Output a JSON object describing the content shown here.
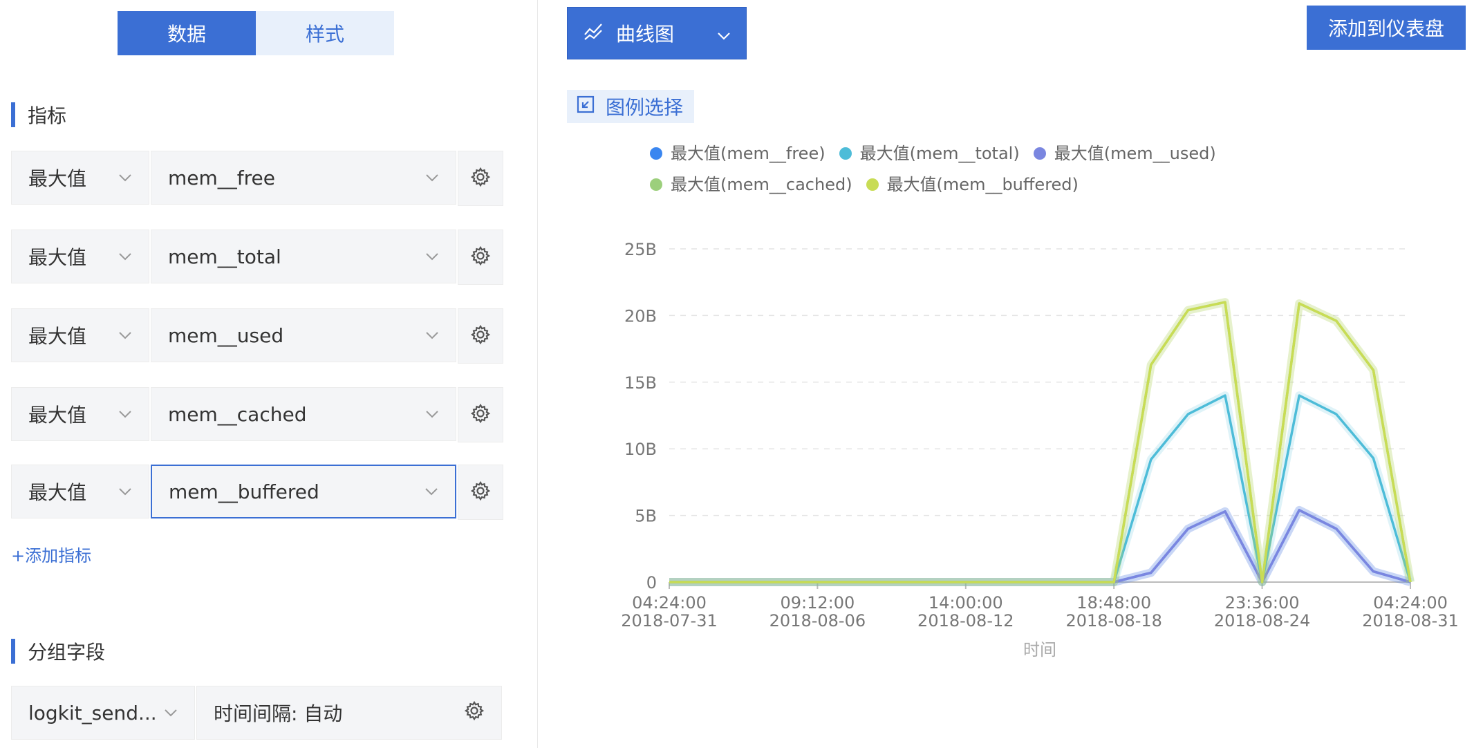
{
  "left": {
    "tabs": [
      {
        "label": "数据",
        "active": true
      },
      {
        "label": "样式",
        "active": false
      }
    ],
    "metrics_title": "指标",
    "metrics": [
      {
        "agg": "最大值",
        "field": "mem__free",
        "focused": false
      },
      {
        "agg": "最大值",
        "field": "mem__total",
        "focused": false
      },
      {
        "agg": "最大值",
        "field": "mem__used",
        "focused": false
      },
      {
        "agg": "最大值",
        "field": "mem__cached",
        "focused": false
      },
      {
        "agg": "最大值",
        "field": "mem__buffered",
        "focused": true
      }
    ],
    "add_metric_label": "+添加指标",
    "group_title": "分组字段",
    "group_field": "logkit_send...",
    "interval_label": "时间间隔: 自动"
  },
  "right": {
    "chart_type_label": "曲线图",
    "add_dashboard_label": "添加到仪表盘",
    "legend_select_label": "图例选择"
  },
  "colors": {
    "accent": "#3b6fd4",
    "free": "#3a86f0",
    "total": "#4dbcd8",
    "used": "#7a86e0",
    "cached": "#9ccf7c",
    "buffered": "#c8dc55"
  },
  "chart_data": {
    "type": "line",
    "xlabel": "时间",
    "ylabel": "",
    "ylim": [
      0,
      25
    ],
    "yticks": [
      "0",
      "5B",
      "10B",
      "15B",
      "20B",
      "25B"
    ],
    "ytick_values": [
      0,
      5,
      10,
      15,
      20,
      25
    ],
    "xticks": [
      {
        "time": "04:24:00",
        "date": "2018-07-31"
      },
      {
        "time": "09:12:00",
        "date": "2018-08-06"
      },
      {
        "time": "14:00:00",
        "date": "2018-08-12"
      },
      {
        "time": "18:48:00",
        "date": "2018-08-18"
      },
      {
        "time": "23:36:00",
        "date": "2018-08-24"
      },
      {
        "time": "04:24:00",
        "date": "2018-08-31"
      }
    ],
    "legend_placement": "top",
    "grid": true,
    "x": [
      0,
      1,
      2,
      3,
      3.5,
      4,
      4.5,
      5,
      5.5,
      6,
      6.5,
      7,
      7.5,
      8,
      8.5,
      9,
      9.5,
      10
    ],
    "series": [
      {
        "name": "最大值(mem__free)",
        "color": "#3a86f0",
        "values": [
          0,
          0,
          0,
          0,
          0,
          0,
          0,
          0,
          0,
          0,
          0.7,
          4.0,
          5.3,
          0,
          5.4,
          4.0,
          0.8,
          0
        ]
      },
      {
        "name": "最大值(mem__total)",
        "color": "#4dbcd8",
        "values": [
          0,
          0,
          0,
          0,
          0,
          0,
          0,
          0,
          0,
          0,
          9.2,
          12.6,
          14.0,
          0,
          14.0,
          12.6,
          9.3,
          0
        ]
      },
      {
        "name": "最大值(mem__used)",
        "color": "#7a86e0",
        "values": [
          0,
          0,
          0,
          0,
          0,
          0,
          0,
          0,
          0,
          0,
          0.7,
          4.0,
          5.3,
          0,
          5.4,
          4.0,
          0.8,
          0
        ]
      },
      {
        "name": "最大值(mem__cached)",
        "color": "#9ccf7c",
        "values": [
          0,
          0,
          0,
          0,
          0,
          0,
          0,
          0,
          0,
          0,
          16.3,
          20.4,
          21.0,
          0,
          20.9,
          19.6,
          15.9,
          0
        ]
      },
      {
        "name": "最大值(mem__buffered)",
        "color": "#c8dc55",
        "values": [
          0,
          0,
          0,
          0,
          0,
          0,
          0,
          0,
          0,
          0,
          16.3,
          20.4,
          21.0,
          0,
          20.9,
          19.6,
          15.9,
          0
        ]
      }
    ]
  }
}
